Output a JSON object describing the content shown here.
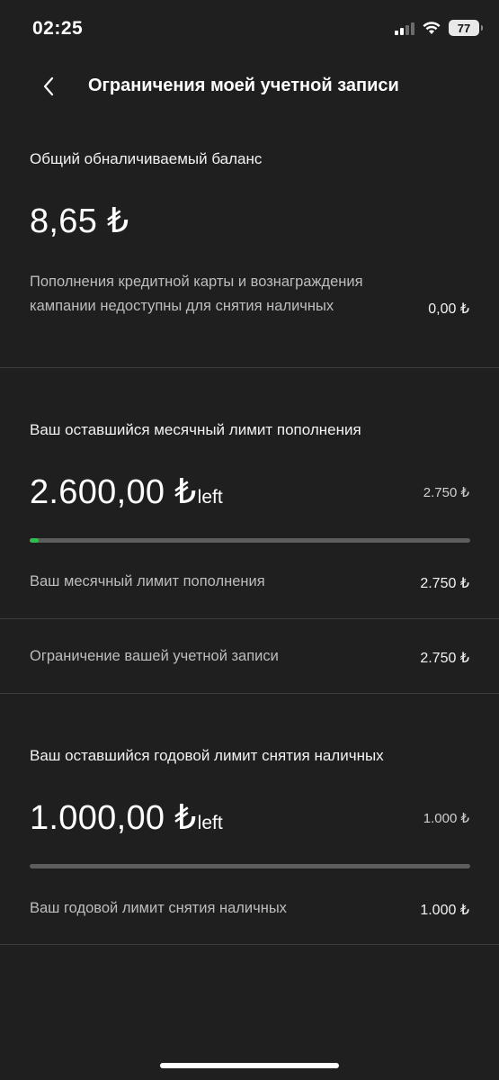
{
  "status_bar": {
    "time": "02:25",
    "battery": "77"
  },
  "header": {
    "title": "Ограничения моей учетной записи"
  },
  "cash_balance": {
    "label": "Общий обналичиваемый баланс",
    "amount": "8,65 ₺",
    "note": "Пополнения кредитной карты и вознаграждения кампании недоступны для снятия наличных",
    "note_value": "0,00 ₺"
  },
  "monthly_topup": {
    "label": "Ваш оставшийся месячный лимит пополнения",
    "amount": "2.600,00 ₺",
    "left_suffix": "left",
    "total": "2.750 ₺",
    "progress": 0.02,
    "progress_color": "#2ebd4e",
    "rows": [
      {
        "label": "Ваш месячный лимит пополнения",
        "value": "2.750 ₺"
      },
      {
        "label": "Ограничение вашей учетной записи",
        "value": "2.750 ₺"
      }
    ]
  },
  "yearly_withdraw": {
    "label": "Ваш оставшийся годовой лимит снятия наличных",
    "amount": "1.000,00 ₺",
    "left_suffix": "left",
    "total": "1.000 ₺",
    "progress": 0,
    "rows": [
      {
        "label": "Ваш годовой лимит снятия наличных",
        "value": "1.000 ₺"
      }
    ]
  },
  "colors": {
    "background": "#1f1f1f",
    "accent_green": "#2ebd4e"
  }
}
